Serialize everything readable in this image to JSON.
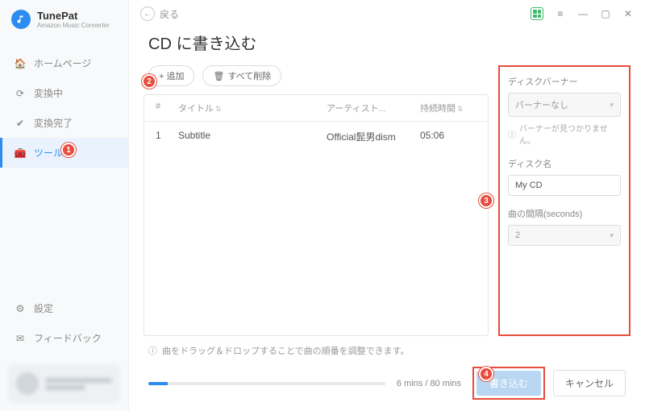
{
  "app": {
    "name": "TunePat",
    "subtitle": "Amazon Music Converter"
  },
  "sidebar": {
    "items": [
      {
        "label": "ホームページ",
        "icon": "home-icon"
      },
      {
        "label": "変換中",
        "icon": "converting-icon"
      },
      {
        "label": "変換完了",
        "icon": "done-icon"
      },
      {
        "label": "ツール",
        "icon": "tools-icon"
      }
    ],
    "bottom": [
      {
        "label": "設定",
        "icon": "settings-icon"
      },
      {
        "label": "フィードバック",
        "icon": "feedback-icon"
      }
    ]
  },
  "header": {
    "back": "戻る"
  },
  "page": {
    "title": "CD に書き込む"
  },
  "actions": {
    "add": "+ 追加",
    "clear_icon": "🗑",
    "clear": "すべて削除"
  },
  "table": {
    "cols": {
      "num": "#",
      "title": "タイトル",
      "artist": "アーティスト...",
      "duration": "持続時間"
    },
    "rows": [
      {
        "num": "1",
        "title": "Subtitle",
        "artist": "Official髭男dism",
        "duration": "05:06"
      }
    ]
  },
  "panel": {
    "burner_label": "ディスクバーナー",
    "burner_value": "バーナーなし",
    "burner_warn": "バーナーが見つかりません。",
    "disc_label": "ディスク名",
    "disc_value": "My CD",
    "gap_label": "曲の間隔(seconds)",
    "gap_value": "2"
  },
  "hint": "曲をドラッグ＆ドロップすることで曲の順番を調整できます。",
  "footer": {
    "time": "6 mins / 80 mins",
    "burn": "書き込む",
    "cancel": "キャンセル"
  },
  "markers": {
    "1": "1",
    "2": "2",
    "3": "3",
    "4": "4"
  }
}
